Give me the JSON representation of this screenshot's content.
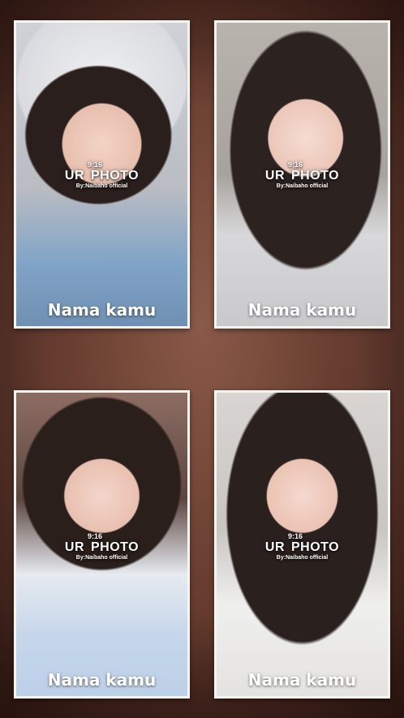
{
  "cards": [
    {
      "ratio": "9:16",
      "brand": "UR  PHOTO",
      "byline": "By:Naibaho official",
      "name": "Nama kamu"
    },
    {
      "ratio": "9:16",
      "brand": "UR  PHOTO",
      "byline": "By:Naibaho official",
      "name": "Nama kamu"
    },
    {
      "ratio": "9:16",
      "brand": "UR  PHOTO",
      "byline": "By:Naibaho official",
      "name": "Nama kamu"
    },
    {
      "ratio": "9:16",
      "brand": "UR  PHOTO",
      "byline": "By:Naibaho official",
      "name": "Nama kamu"
    }
  ],
  "colors": {
    "background": "#6a3f31",
    "frame": "#f4f4f1",
    "text": "#ffffff"
  }
}
